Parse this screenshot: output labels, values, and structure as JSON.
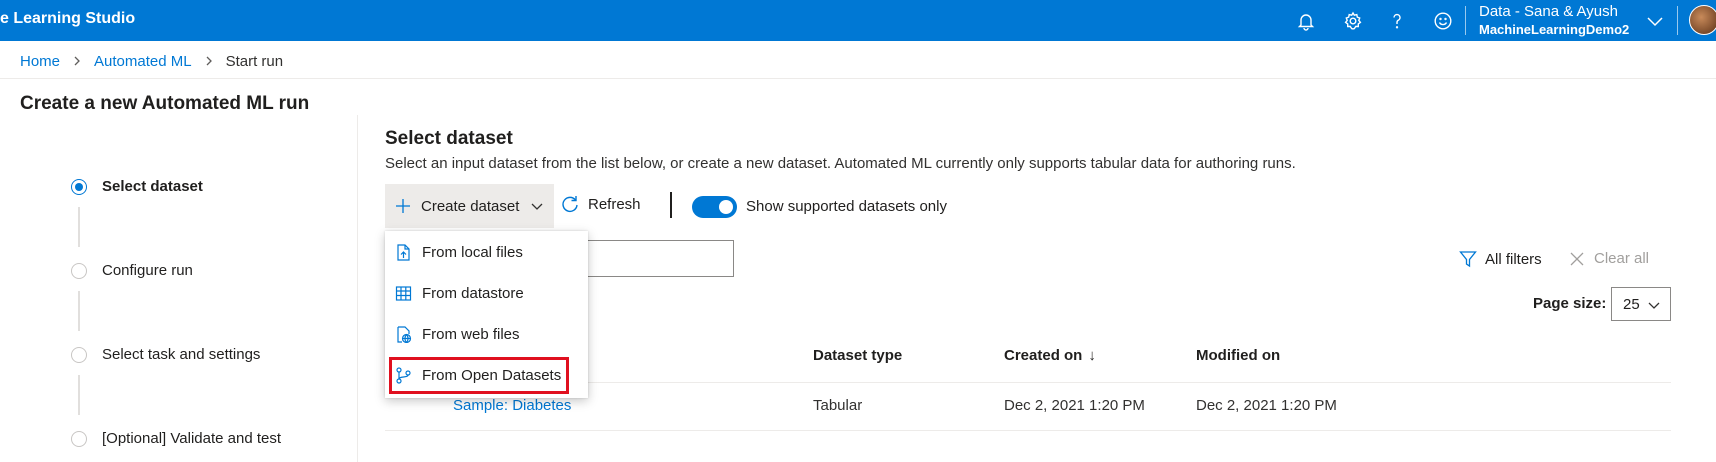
{
  "app": {
    "title": "e Learning Studio"
  },
  "topbar": {
    "icons": [
      "bell-icon",
      "gear-icon",
      "help-icon",
      "smiley-icon"
    ],
    "workspace_line1": "Data - Sana & Ayush",
    "workspace_line2": "MachineLearningDemo2"
  },
  "breadcrumb": {
    "items": [
      "Home",
      "Automated ML",
      "Start run"
    ]
  },
  "page": {
    "title": "Create a new Automated ML run"
  },
  "stepper": {
    "steps": [
      {
        "label": "Select dataset",
        "state": "active"
      },
      {
        "label": "Configure run",
        "state": "inactive"
      },
      {
        "label": "Select task and settings",
        "state": "inactive"
      },
      {
        "label": "[Optional] Validate and test",
        "state": "inactive"
      }
    ]
  },
  "section": {
    "title": "Select dataset",
    "description": "Select an input dataset from the list below, or create a new dataset. Automated ML currently only supports tabular data for authoring runs."
  },
  "commandbar": {
    "create_label": "Create dataset",
    "refresh_label": "Refresh",
    "toggle_label": "Show supported datasets only",
    "toggle_on": true
  },
  "dropdown": {
    "items": [
      {
        "label": "From local files",
        "icon": "upload-file-icon"
      },
      {
        "label": "From datastore",
        "icon": "table-grid-icon"
      },
      {
        "label": "From web files",
        "icon": "web-file-icon"
      },
      {
        "label": "From Open Datasets",
        "icon": "open-datasets-icon"
      }
    ],
    "highlighted": "From Open Datasets"
  },
  "filters": {
    "all_filters_label": "All filters",
    "clear_all_label": "Clear all"
  },
  "pagination": {
    "page_size_label": "Page size:",
    "page_size_value": "25"
  },
  "table": {
    "columns": [
      "Dataset type",
      "Created on",
      "Modified on"
    ],
    "sort_indicator": "↓",
    "rows": [
      {
        "name": "Sample: Diabetes",
        "type": "Tabular",
        "created": "Dec 2, 2021 1:20 PM",
        "modified": "Dec 2, 2021 1:20 PM"
      }
    ]
  },
  "colors": {
    "brand": "#0078d4",
    "highlight": "#e0101f"
  }
}
